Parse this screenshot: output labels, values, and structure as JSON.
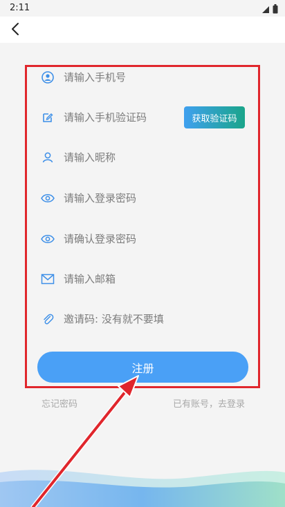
{
  "status": {
    "time": "2:11"
  },
  "nav": {
    "back_label": "<"
  },
  "form": {
    "phone": {
      "placeholder": "请输入手机号"
    },
    "sms_code": {
      "placeholder": "请输入手机验证码",
      "button": "获取验证码"
    },
    "nickname": {
      "placeholder": "请输入昵称"
    },
    "password": {
      "placeholder": "请输入登录密码"
    },
    "confirm_password": {
      "placeholder": "请确认登录密码"
    },
    "email": {
      "placeholder": "请输入邮箱"
    },
    "invite": {
      "placeholder": "邀请码: 没有就不要填"
    }
  },
  "actions": {
    "register": "注册",
    "forgot": "忘记密码",
    "login": "已有账号，去登录"
  },
  "colors": {
    "accent": "#4aa0f6",
    "highlight": "#e0262c",
    "code_gradient_start": "#3fa0ef",
    "code_gradient_end": "#1aa58a"
  }
}
